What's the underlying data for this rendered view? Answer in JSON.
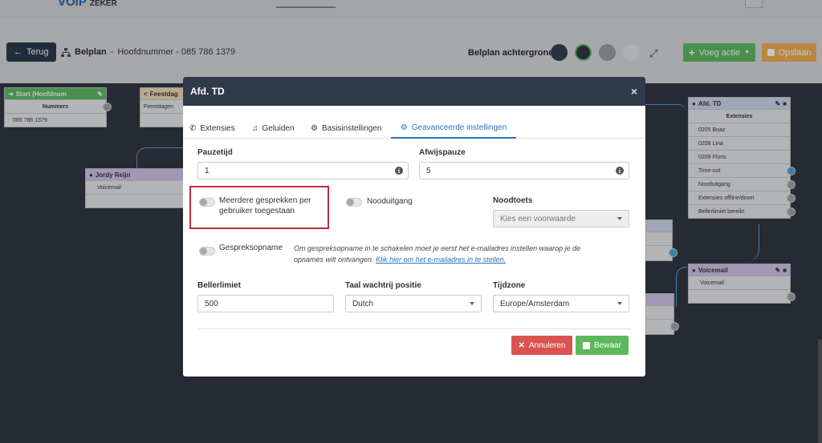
{
  "logo": {
    "brand": "VOIP",
    "tagline": "ZEKER"
  },
  "toolbar": {
    "back_label": "Terug",
    "belplan_label": "Belplan",
    "belplan_name": "Hoofdnummer - 085 786 1379",
    "background_label": "Belplan achtergrond",
    "swatches": [
      "#2f3a4a",
      "#2c303a",
      "#9b9b9b",
      "#e3e3e3"
    ],
    "add_action_label": "Voeg actie",
    "save_label": "Opslaan"
  },
  "nodes": {
    "start": {
      "title": "Start (Hoofdnum",
      "header_color": "#5cb85c",
      "rows": [
        "Nummers",
        "085 786 1379"
      ]
    },
    "feestdagen": {
      "title": "Feestdag",
      "header_color": "#f3d9b4",
      "rows": [
        "Feestdagen"
      ]
    },
    "jordy": {
      "title": "Jordy Reijn",
      "header_color": "#cfc3e6",
      "rows": [
        "Voicemail"
      ]
    },
    "afd_td": {
      "title": "Afd. TD",
      "header_color": "#cfd6e9",
      "rows": [
        "Extensies",
        "0205 Boaz",
        "0208 Lina",
        "0209 Floris",
        "Time-out",
        "Nooduitgang",
        "Extensies offline/down",
        "Bellerlimiet bereikt"
      ]
    },
    "voicemail": {
      "title": "Voicemail",
      "header_color": "#cfc3e6",
      "rows": [
        "Voicemail"
      ]
    }
  },
  "modal": {
    "title": "Afd. TD",
    "close": "×",
    "tabs": [
      {
        "label": "Extensies",
        "icon": "phone-icon"
      },
      {
        "label": "Geluiden",
        "icon": "music-icon"
      },
      {
        "label": "Basisinstellingen",
        "icon": "gear-icon"
      },
      {
        "label": "Geavanceerde instellingen",
        "icon": "gear-icon",
        "active": true
      }
    ],
    "pauzetijd": {
      "label": "Pauzetijd",
      "value": "1"
    },
    "afwijspauze": {
      "label": "Afwijspauze",
      "value": "5"
    },
    "meerdere": {
      "label_line1": "Meerdere gesprekken per",
      "label_line2": "gebruiker toegestaan",
      "on": false
    },
    "nooduitgang": {
      "label": "Nooduitgang",
      "on": false
    },
    "noodtoets": {
      "label": "Noodtoets",
      "placeholder": "Kies een voorwaarde"
    },
    "gespreksopname": {
      "label": "Gespreksopname",
      "on": false,
      "hint_line1": "Om gespreksopname in te schakelen moet je eerst het e-mailadres instellen waarop je de",
      "hint_line2": "opnames wilt ontvangen.",
      "hint_link": "Klik hier om het e-mailadres in te stellen."
    },
    "bellerlimiet": {
      "label": "Bellerlimiet",
      "value": "500"
    },
    "taal": {
      "label": "Taal wachtrij positie",
      "value": "Dutch"
    },
    "tijdzone": {
      "label": "Tijdzone",
      "value": "Europe/Amsterdam"
    },
    "cancel_label": "Annuleren",
    "keep_label": "Bewaar"
  }
}
